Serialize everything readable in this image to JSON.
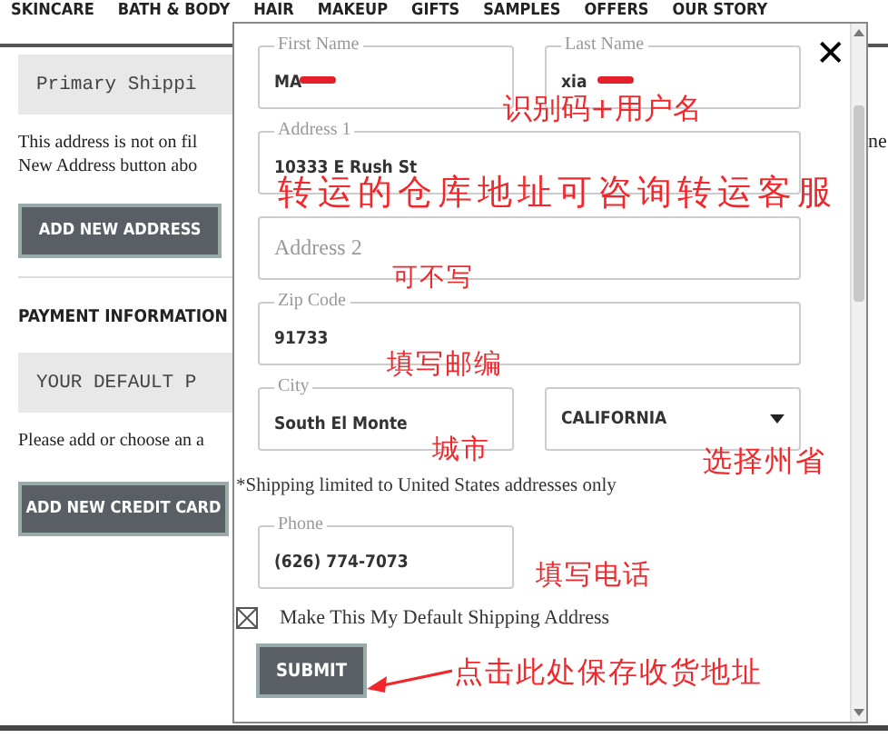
{
  "nav": {
    "items": [
      "SKINCARE",
      "BATH & BODY",
      "HAIR",
      "MAKEUP",
      "GIFTS",
      "SAMPLES",
      "OFFERS",
      "OUR STORY"
    ]
  },
  "page": {
    "shipping_box": "Primary Shippi",
    "shipping_note_lines": [
      "This address is not on fil",
      "New Address button abo"
    ],
    "add_address_button": "ADD NEW ADDRESS",
    "payment_heading": "PAYMENT INFORMATION",
    "payment_box": "YOUR DEFAULT P",
    "payment_note": "Please add or choose an a",
    "add_card_button": "ADD NEW CREDIT CARD",
    "edge_text": "ne"
  },
  "modal": {
    "close": "✕",
    "rows": [
      [
        {
          "kind": "text",
          "label": "First Name",
          "value": "MA",
          "redacted": true
        },
        {
          "kind": "text",
          "label": "Last Name",
          "value": "xia",
          "redacted": true
        }
      ],
      [
        {
          "kind": "text",
          "label": "Address 1",
          "value": "10333 E Rush St",
          "redacted": false
        }
      ],
      [
        {
          "kind": "text",
          "placeholder": "Address 2",
          "redacted": false
        }
      ],
      [
        {
          "kind": "text",
          "label": "Zip Code",
          "value": "91733",
          "redacted": false
        }
      ],
      [
        {
          "kind": "text",
          "label": "City",
          "value": "South El Monte",
          "redacted": false
        },
        {
          "kind": "select",
          "value": "CALIFORNIA"
        }
      ]
    ],
    "shipping_note": "*Shipping limited to United States addresses only",
    "phone": {
      "label": "Phone",
      "value": "(626) 774-7073"
    },
    "default_checkbox": {
      "label": "Make This My Default Shipping Address",
      "checked": true
    },
    "submit": "SUBMIT"
  },
  "annotations": [
    {
      "kind": "note",
      "text": "识别码+用户名"
    },
    {
      "kind": "note",
      "text": "转运的仓库地址可咨询转运客服"
    },
    {
      "kind": "note",
      "text": "可不写"
    },
    {
      "kind": "note",
      "text": "填写邮编"
    },
    {
      "kind": "note",
      "text": "城市"
    },
    {
      "kind": "note",
      "text": "选择州省"
    },
    {
      "kind": "note",
      "text": "填写电话"
    },
    {
      "kind": "arrow",
      "text": "点击此处保存收货地址"
    }
  ]
}
